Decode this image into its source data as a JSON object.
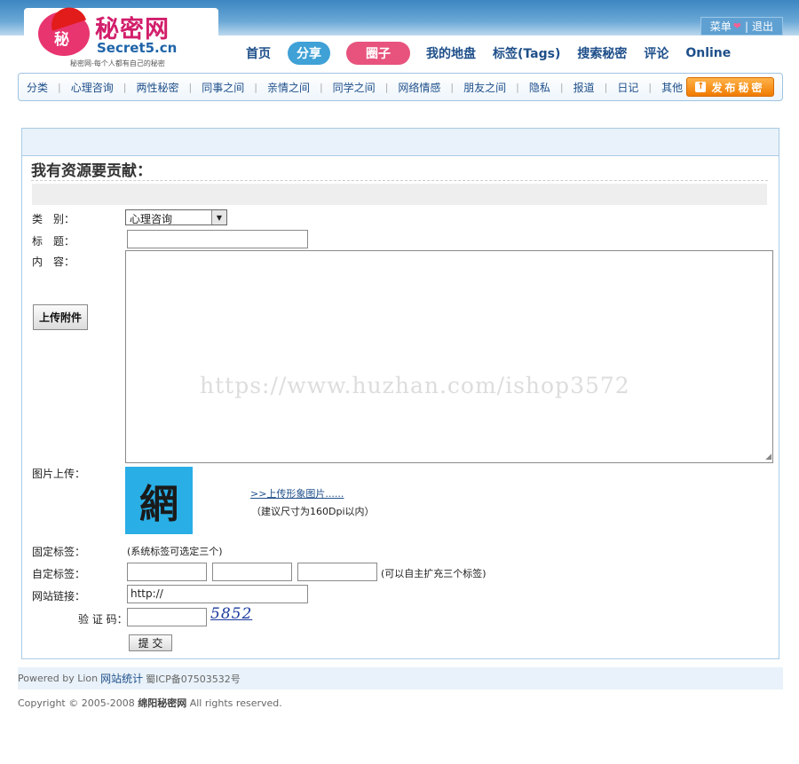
{
  "header": {
    "logo_badge": "秘",
    "logo_title": "秘密网",
    "logo_domain": "Secret5.cn",
    "logo_slogan": "秘密网-每个人都有自己的秘密",
    "user_menu": "菜单",
    "logout": "退出",
    "sep": "|"
  },
  "nav": {
    "home": "首页",
    "share": "分享",
    "circle": "圈子",
    "my_site": "我的地盘",
    "tags": "标签(Tags)",
    "search": "搜索秘密",
    "comments": "评论",
    "online": "Online"
  },
  "categories": [
    "分类",
    "心理咨询",
    "两性秘密",
    "同事之间",
    "亲情之间",
    "同学之间",
    "网络情感",
    "朋友之间",
    "隐私",
    "报道",
    "日记",
    "其他"
  ],
  "category_sep": "|",
  "publish_button": "发布秘密",
  "publish_arrow": "↑",
  "form": {
    "title": "我有资源要贡献：",
    "category_label": "类　别：",
    "category_value": "心理咨询",
    "title_label": "标　题：",
    "title_value": "",
    "content_label": "内　容：",
    "upload_attachment": "上传附件",
    "watermark": "https://www.huzhan.com/ishop3572",
    "image_label": "图片上传：",
    "avatar_char": "網",
    "upload_image_link": ">>上传形象图片......",
    "upload_image_hint": "（建议尺寸为160Dpi以内）",
    "fixed_tags_label": "固定标签：",
    "fixed_tags_hint": "(系统标签可选定三个)",
    "custom_tags_label": "自定标签：",
    "custom_tags_hint": "(可以自主扩充三个标签)",
    "website_label": "网站链接：",
    "website_value": "http://",
    "captcha_label": "验 证 码：",
    "captcha_value": "5852",
    "submit": "提 交"
  },
  "footer": {
    "powered_by": "Powered by Lion",
    "stats_link": "网站统计",
    "icp": "蜀ICP备07503532号",
    "copyright_pre": "Copyright © 2005-2008",
    "site_name": "绵阳秘密网",
    "copyright_post": "All rights reserved."
  },
  "colors": {
    "nav_text": "#1e4f8a",
    "top_bar": "#3c86c2",
    "publish": "#f07b00",
    "logo_pink": "#d21e6b"
  }
}
